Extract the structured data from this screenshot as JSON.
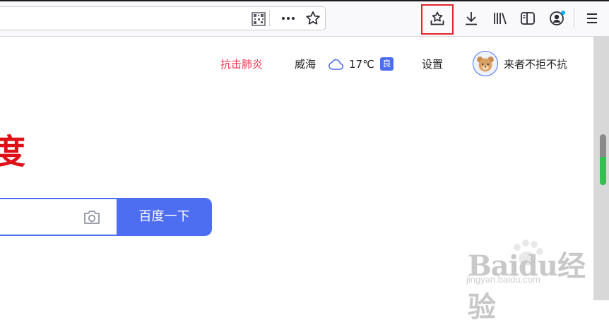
{
  "browser": {
    "url_bar": {
      "value": ""
    },
    "icons": {
      "qr": "qr-code-icon",
      "more": "more-actions-icon",
      "bookmark": "bookmark-star-icon",
      "save_to_pocket": "pocket-save-icon",
      "download": "download-icon",
      "library": "library-icon",
      "sidebar": "sidebar-icon",
      "account": "account-icon",
      "menu": "hamburger-menu-icon"
    },
    "highlight_color": "#e0242a"
  },
  "nav": {
    "fight": "抗击肺炎",
    "city": "威海",
    "temperature": "17℃",
    "aqi": "良",
    "settings": "设置",
    "username": "来者不拒不抗"
  },
  "logo": {
    "fragment": "度"
  },
  "search": {
    "input_value": "",
    "button": "百度一下"
  },
  "watermark": {
    "title": "Baidu经验",
    "subtitle": "jingyan.baidu.com"
  },
  "colors": {
    "accent": "#4e6ef2",
    "logo_red": "#de0f17",
    "fight_red": "#f0334e",
    "scroll_green": "#2fc050"
  }
}
